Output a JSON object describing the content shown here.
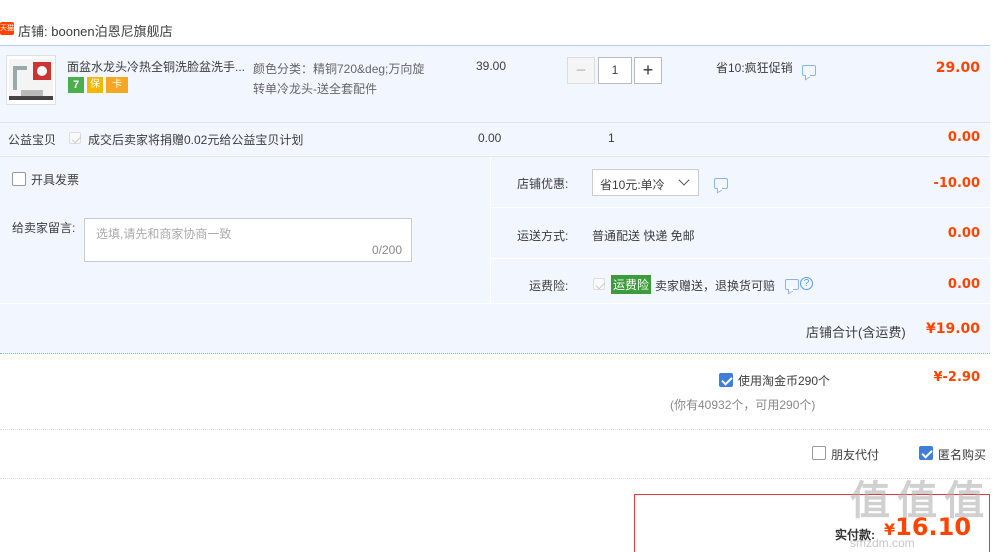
{
  "store": {
    "badge": "天猫",
    "label": "店铺:",
    "name": "boonen泊恩尼旗舰店"
  },
  "item": {
    "title": "面盆水龙头冷热全铜洗脸盆洗手...",
    "badges": [
      "7",
      "保",
      "卡"
    ],
    "sku_line1": "颜色分类：精铜720&deg;万向旋",
    "sku_line2": "转单冷龙头-送全套配件",
    "price": "39.00",
    "qty": "1",
    "promo": "省10:疯狂促销",
    "subtotal": "29.00"
  },
  "charity": {
    "label": "公益宝贝",
    "desc": "成交后卖家将捐赠0.02元给公益宝贝计划",
    "price": "0.00",
    "qty": "1",
    "subtotal": "0.00"
  },
  "invoice": {
    "label": "开具发票"
  },
  "message": {
    "label": "给卖家留言:",
    "placeholder": "选填,请先和商家协商一致",
    "counter": "0/200"
  },
  "discount": {
    "label": "店铺优惠:",
    "value": "省10元:单冷",
    "amount": "-10.00"
  },
  "shipping": {
    "label": "运送方式:",
    "value": "普通配送 快递 免邮",
    "amount": "0.00"
  },
  "insurance": {
    "label": "运费险:",
    "tag": "运费险",
    "desc": "卖家赠送，退换货可赔",
    "amount": "0.00"
  },
  "store_total": {
    "label": "店铺合计(含运费)",
    "amount": "¥19.00"
  },
  "coins": {
    "label": "使用淘金币290个",
    "amount": "¥-2.90",
    "note": "(你有40932个，可用290个)"
  },
  "options": {
    "friend_pay": "朋友代付",
    "anonymous": "匿名购买"
  },
  "payment": {
    "label": "实付款:",
    "amount": "16.10",
    "currency": "¥"
  },
  "watermark": {
    "text": "值 值 值",
    "domain": "smzdm.com"
  },
  "colors": {
    "accent": "#f40",
    "panel": "#f2f7ff",
    "checkbox": "#3f7fd9"
  }
}
